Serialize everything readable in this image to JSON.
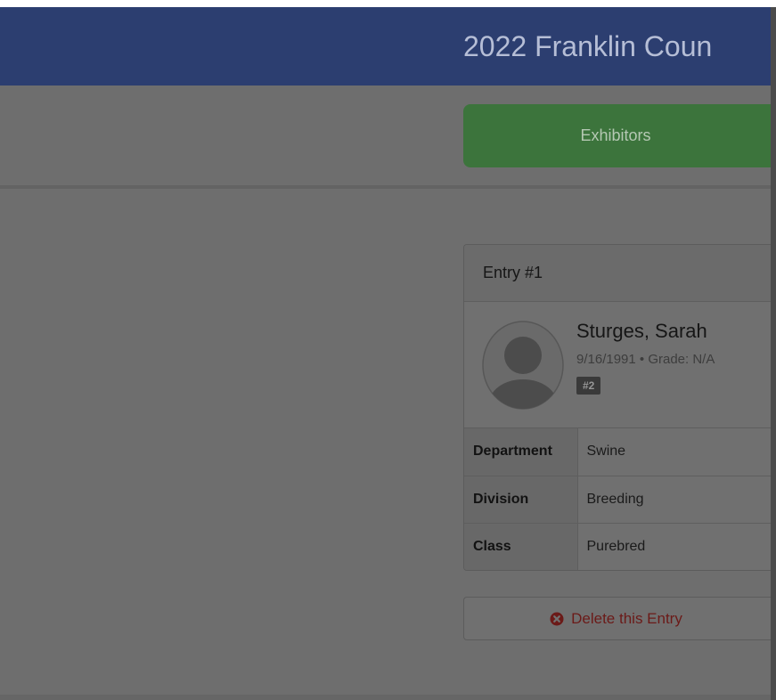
{
  "header": {
    "title": "2022 Franklin Coun"
  },
  "nav": {
    "exhibitors_label": "Exhibitors"
  },
  "entry": {
    "heading": "Entry #1",
    "exhibitor_name": "Sturges, Sarah",
    "exhibitor_meta": "9/16/1991 • Grade: N/A",
    "badge": "#2",
    "rows": [
      {
        "label": "Department",
        "value": "Swine"
      },
      {
        "label": "Division",
        "value": "Breeding"
      },
      {
        "label": "Class",
        "value": "Purebred"
      }
    ],
    "delete_label": "Delete this Entry"
  },
  "icons": {
    "avatar": "user-avatar-icon",
    "delete": "circle-x-icon"
  },
  "colors": {
    "header_bg": "#2c3e70",
    "exhibitors_bg": "#3c743c",
    "delete_text": "#6b1a18"
  }
}
